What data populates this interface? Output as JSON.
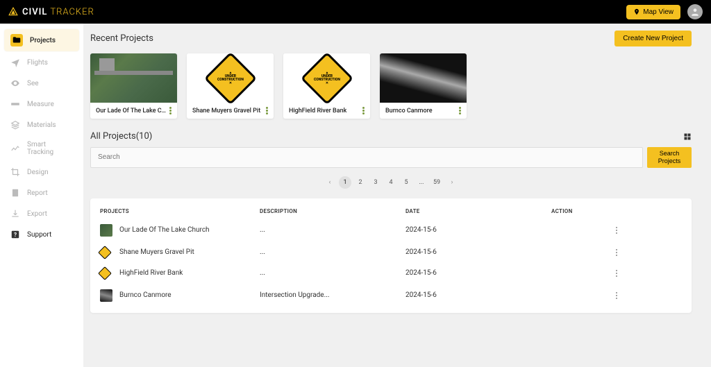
{
  "header": {
    "brand_civil": "CIVIL",
    "brand_tracker": "TRACKER",
    "map_view": "Map View"
  },
  "sidebar": {
    "items": [
      {
        "label": "Projects"
      },
      {
        "label": "Flights"
      },
      {
        "label": "See"
      },
      {
        "label": "Measure"
      },
      {
        "label": "Materials"
      },
      {
        "label": "Smart Tracking"
      },
      {
        "label": "Design"
      },
      {
        "label": "Report"
      },
      {
        "label": "Export"
      },
      {
        "label": "Support"
      }
    ]
  },
  "recent": {
    "title": "Recent Projects",
    "create_label": "Create New Project",
    "cards": [
      {
        "title": "Our Lade Of The Lake Church"
      },
      {
        "title": "Shane Muyers Gravel Pit"
      },
      {
        "title": "HighField River Bank"
      },
      {
        "title": "Burnco Canmore"
      }
    ]
  },
  "all": {
    "title": "All Projects(10)",
    "search_placeholder": "Search",
    "search_button": "Search Projects"
  },
  "pagination": {
    "prev": "‹",
    "pages": [
      "1",
      "2",
      "3",
      "4",
      "5",
      "...",
      "59"
    ],
    "next": "›"
  },
  "table": {
    "headers": {
      "projects": "PROJECTS",
      "description": "DESCRIPTION",
      "date": "DATE",
      "action": "ACTION"
    },
    "rows": [
      {
        "name": "Our Lade Of The Lake Church",
        "desc": "...",
        "date": "2024-15-6"
      },
      {
        "name": "Shane Muyers Gravel Pit",
        "desc": "...",
        "date": "2024-15-6"
      },
      {
        "name": "HighField River Bank",
        "desc": "...",
        "date": "2024-15-6"
      },
      {
        "name": "Burnco Canmore",
        "desc": "Intersection Upgrade...",
        "date": "2024-15-6"
      }
    ]
  }
}
